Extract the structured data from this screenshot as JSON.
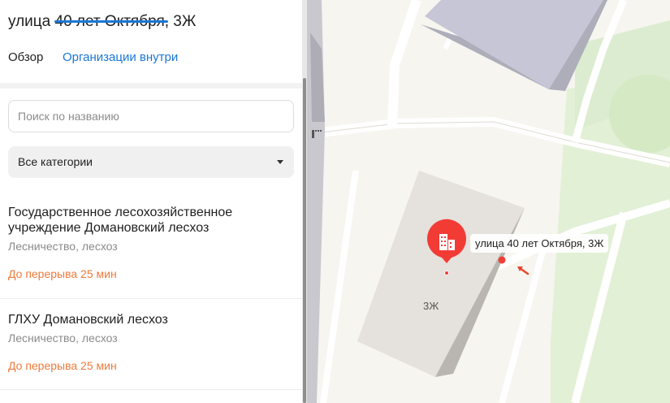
{
  "panel": {
    "title": "улица 40 лет Октября, 3Ж",
    "tabs": [
      {
        "label": "Обзор",
        "active": false
      },
      {
        "label": "Организации внутри",
        "active": true
      }
    ],
    "search": {
      "placeholder": "Поиск по названию",
      "value": ""
    },
    "category": {
      "selected": "Все категории"
    },
    "organizations": [
      {
        "name": "Государственное лесохозяйственное учреждение Домановский лесхоз",
        "category": "Лесничество, лесхоз",
        "status": "До перерыва 25 мин"
      },
      {
        "name": "ГЛХУ Домановский лесхоз",
        "category": "Лесничество, лесхоз",
        "status": "До перерыва 25 мин"
      }
    ]
  },
  "map": {
    "address_label": "улица 40 лет Октября, 3Ж",
    "building_number": "3Ж",
    "pin_icon": "office-building-icon",
    "colors": {
      "accent": "#1a77d6",
      "status": "#ee7a3b",
      "pin": "#f33b36",
      "background": "#f6f5ef",
      "park": "#e2f0d6",
      "building_roof": "#e5e1dc",
      "building_side": "#b9b6b2",
      "road": "#ffffff"
    }
  }
}
